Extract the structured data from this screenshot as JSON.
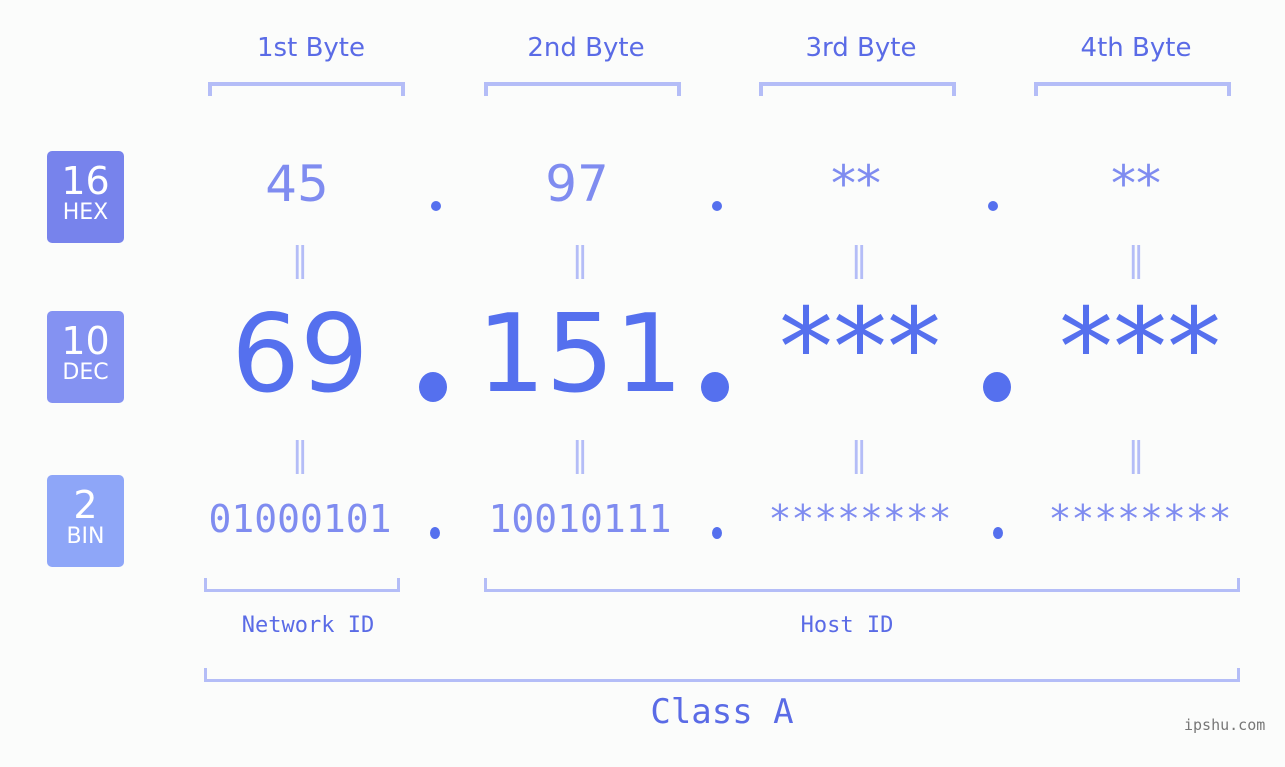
{
  "headers": [
    "1st Byte",
    "2nd Byte",
    "3rd Byte",
    "4th Byte"
  ],
  "bases": {
    "hex": {
      "num": "16",
      "unit": "HEX",
      "color": "#7783ec"
    },
    "dec": {
      "num": "10",
      "unit": "DEC",
      "color": "#8492f2"
    },
    "bin": {
      "num": "2",
      "unit": "BIN",
      "color": "#8ea6f8"
    }
  },
  "hex_values": [
    "45",
    "97",
    "**",
    "**"
  ],
  "dec_values": [
    "69",
    "151",
    "***",
    "***"
  ],
  "bin_values": [
    "01000101",
    "10010111",
    "********",
    "********"
  ],
  "equals_sign": "=",
  "network_id_label": "Network ID",
  "host_id_label": "Host ID",
  "class_label": "Class A",
  "watermark": "ipshu.com",
  "colors": {
    "accent": "#5570ee",
    "light_accent": "#7f8cf0",
    "bracket": "#b4bdf7",
    "label": "#5a6be6",
    "background": "#fbfcfb"
  }
}
